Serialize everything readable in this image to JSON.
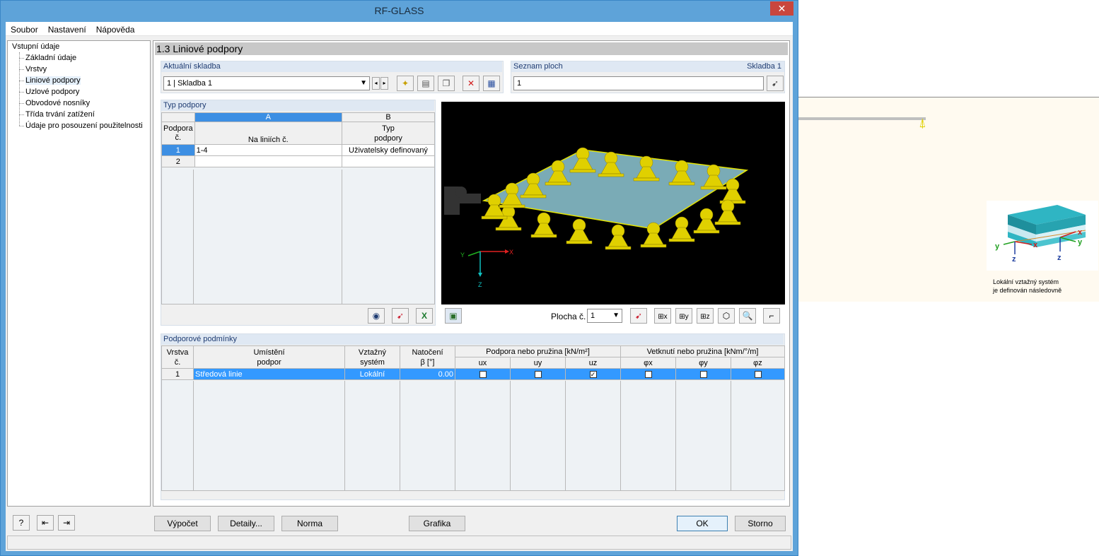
{
  "window": {
    "title": "RF-GLASS",
    "close_glyph": "✕"
  },
  "menu": [
    "Soubor",
    "Nastavení",
    "Nápověda"
  ],
  "nav": {
    "root": "Vstupní údaje",
    "items": [
      "Základní údaje",
      "Vrstvy",
      "Liniové podpory",
      "Uzlové podpory",
      "Obvodové nosníky",
      "Třída trvání zatížení",
      "Údaje pro posouzení použitelnosti"
    ]
  },
  "panel": {
    "title": "1.3 Liniové podpory"
  },
  "skladba": {
    "label": "Aktuální skladba",
    "value": "1 | Skladba 1",
    "icons": [
      "new-icon",
      "edit-icon",
      "copy-icon",
      "delete-icon",
      "import-icon"
    ]
  },
  "plochy": {
    "label": "Seznam ploch",
    "right_label": "Skladba 1",
    "value": "1"
  },
  "typ": {
    "label": "Typ podpory",
    "col_a": "A",
    "col_b": "B",
    "hdr_rowno_1": "Podpora",
    "hdr_rowno_2": "č.",
    "hdr_a": "Na liniích č.",
    "hdr_b_1": "Typ",
    "hdr_b_2": "podpory",
    "rows": [
      {
        "no": "1",
        "a": "1-4",
        "b": "Uživatelsky definovaný"
      },
      {
        "no": "2",
        "a": "",
        "b": ""
      }
    ]
  },
  "view": {
    "plocha_label": "Plocha č.",
    "plocha_value": "1",
    "axis_x": "X",
    "axis_y": "Y",
    "axis_z": "Z"
  },
  "podminky": {
    "label": "Podporové podmínky",
    "h_vrstva_1": "Vrstva",
    "h_vrstva_2": "č.",
    "h_umisteni_1": "Umístění",
    "h_umisteni_2": "podpor",
    "h_vztazny_1": "Vztažný",
    "h_vztazny_2": "systém",
    "h_natoceni_1": "Natočení",
    "h_natoceni_2": "β [°]",
    "h_podpora": "Podpora nebo pružina [kN/m²]",
    "h_vetknuti": "Vetknutí nebo pružina [kNm/°/m]",
    "sub": [
      "ux",
      "uy",
      "uz",
      "φx",
      "φy",
      "φz"
    ],
    "rows": [
      {
        "no": "1",
        "umisteni": "Středová linie",
        "system": "Lokální",
        "beta": "0.00",
        "checks": [
          false,
          false,
          true,
          false,
          false,
          false
        ]
      }
    ]
  },
  "buttons": {
    "vypocet": "Výpočet",
    "detaily": "Detaily...",
    "norma": "Norma",
    "grafika": "Grafika",
    "ok": "OK",
    "storno": "Storno"
  },
  "info": {
    "line1": "Lokální vztažný systém",
    "line2": "je definován následovně",
    "axis_y": "y",
    "axis_x": "x",
    "axis_z": "z"
  }
}
